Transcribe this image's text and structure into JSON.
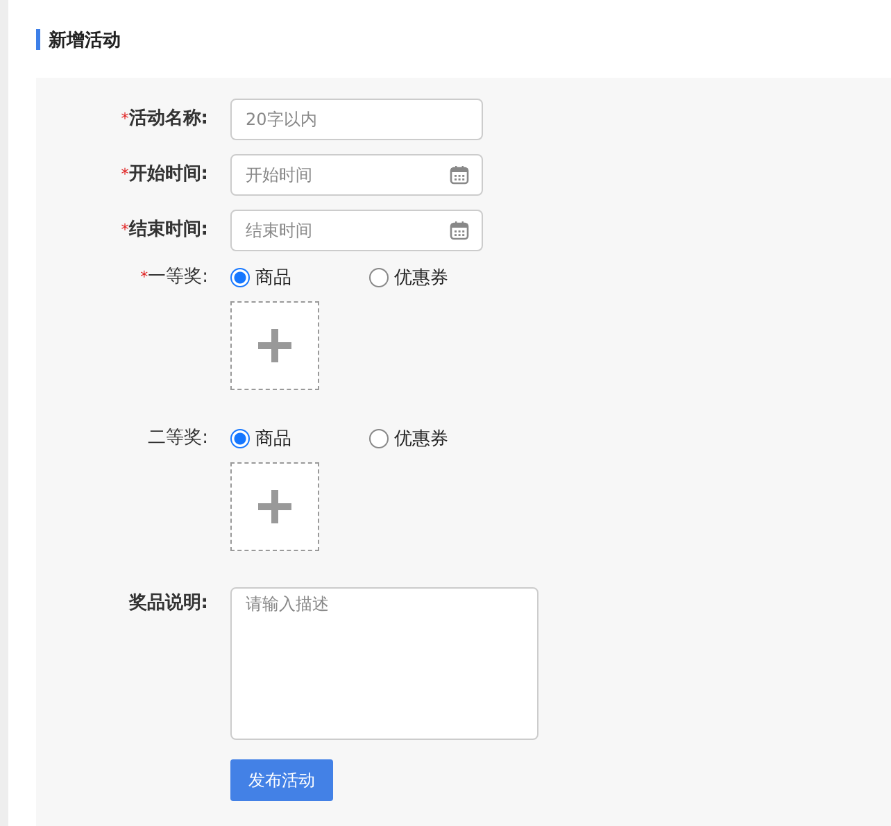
{
  "title": "新增活动",
  "fields": [
    {
      "kind": "text",
      "mark": "*",
      "label": "活动名称:",
      "placeholder": "20字以内"
    },
    {
      "kind": "date",
      "mark": "*",
      "label": "开始时间:",
      "placeholder": "开始时间"
    },
    {
      "kind": "date",
      "mark": "*",
      "label": "结束时间:",
      "placeholder": "结束时间"
    },
    {
      "kind": "prize",
      "mark": "*",
      "label": "一等奖:",
      "options": [
        {
          "label": "商品",
          "selected": true
        },
        {
          "label": "优惠券",
          "selected": false
        }
      ]
    },
    {
      "kind": "prize",
      "label": "二等奖:",
      "options": [
        {
          "label": "商品",
          "selected": true
        },
        {
          "label": "优惠券",
          "selected": false
        }
      ]
    },
    {
      "kind": "textarea",
      "label": "奖品说明:",
      "placeholder": "请输入描述"
    }
  ],
  "submit": "发布活动"
}
